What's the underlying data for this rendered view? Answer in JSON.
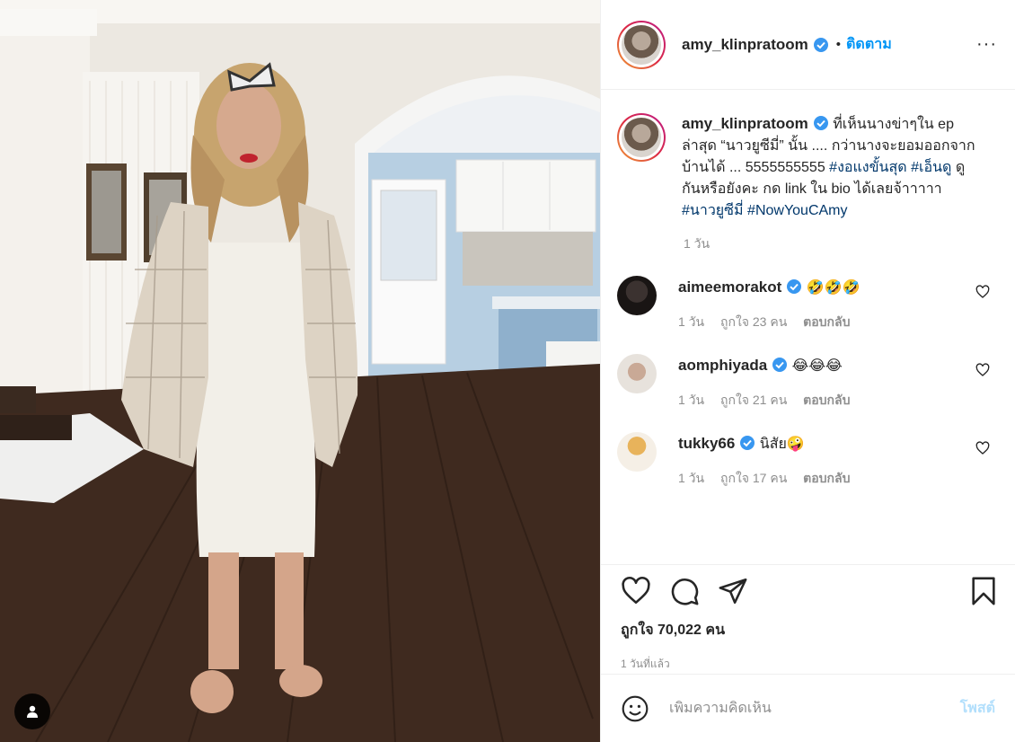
{
  "post": {
    "username": "amy_klinpratoom",
    "follow_label": "ติดตาม",
    "dot": "•",
    "more": "···",
    "caption": {
      "text1": "ที่เห็นนางข่าๆใน ep ล่าสุด “นาวยูซีมี่” นั้น .... กว่านางจะยอมออกจากบ้านได้ ... 5555555555 ",
      "hash1": "#งอแงขั้นสุด",
      "hash2": "#เอ็นดู",
      "text2": " ดูกันหรือยังคะ กด link ใน bio ได้เลยจ้าาาาา ",
      "hash3": "#นาวยูซีมี่",
      "hash4": "#NowYouCAmy"
    },
    "caption_time": "1 วัน",
    "comments": [
      {
        "user": "aimeemorakot",
        "text": "🤣🤣🤣",
        "time": "1 วัน",
        "likes": "ถูกใจ 23 คน",
        "reply": "ตอบกลับ"
      },
      {
        "user": "aomphiyada",
        "text": "😂😂😂",
        "time": "1 วัน",
        "likes": "ถูกใจ 21 คน",
        "reply": "ตอบกลับ"
      },
      {
        "user": "tukky66",
        "text": "นิสัย🤪",
        "time": "1 วัน",
        "likes": "ถูกใจ 17 คน",
        "reply": "ตอบกลับ"
      }
    ],
    "likes_total": "ถูกใจ 70,022 คน",
    "posted_ago": "1 วันที่แล้ว"
  },
  "composer": {
    "placeholder": "เพิ่มความคิดเห็น",
    "post_label": "โพสต์"
  },
  "colors": {
    "accent": "#0095f6",
    "hashtag": "#00376b",
    "muted": "#8e8e8e",
    "post_disabled": "#b2dffc",
    "verified": "#3897f0"
  },
  "icons": {
    "tag": "user-tag-icon",
    "verified": "verified-badge-icon",
    "like": "heart-icon",
    "comment": "comment-icon",
    "share": "send-icon",
    "save": "bookmark-icon",
    "emoji": "emoji-icon",
    "more": "more-options-icon"
  }
}
